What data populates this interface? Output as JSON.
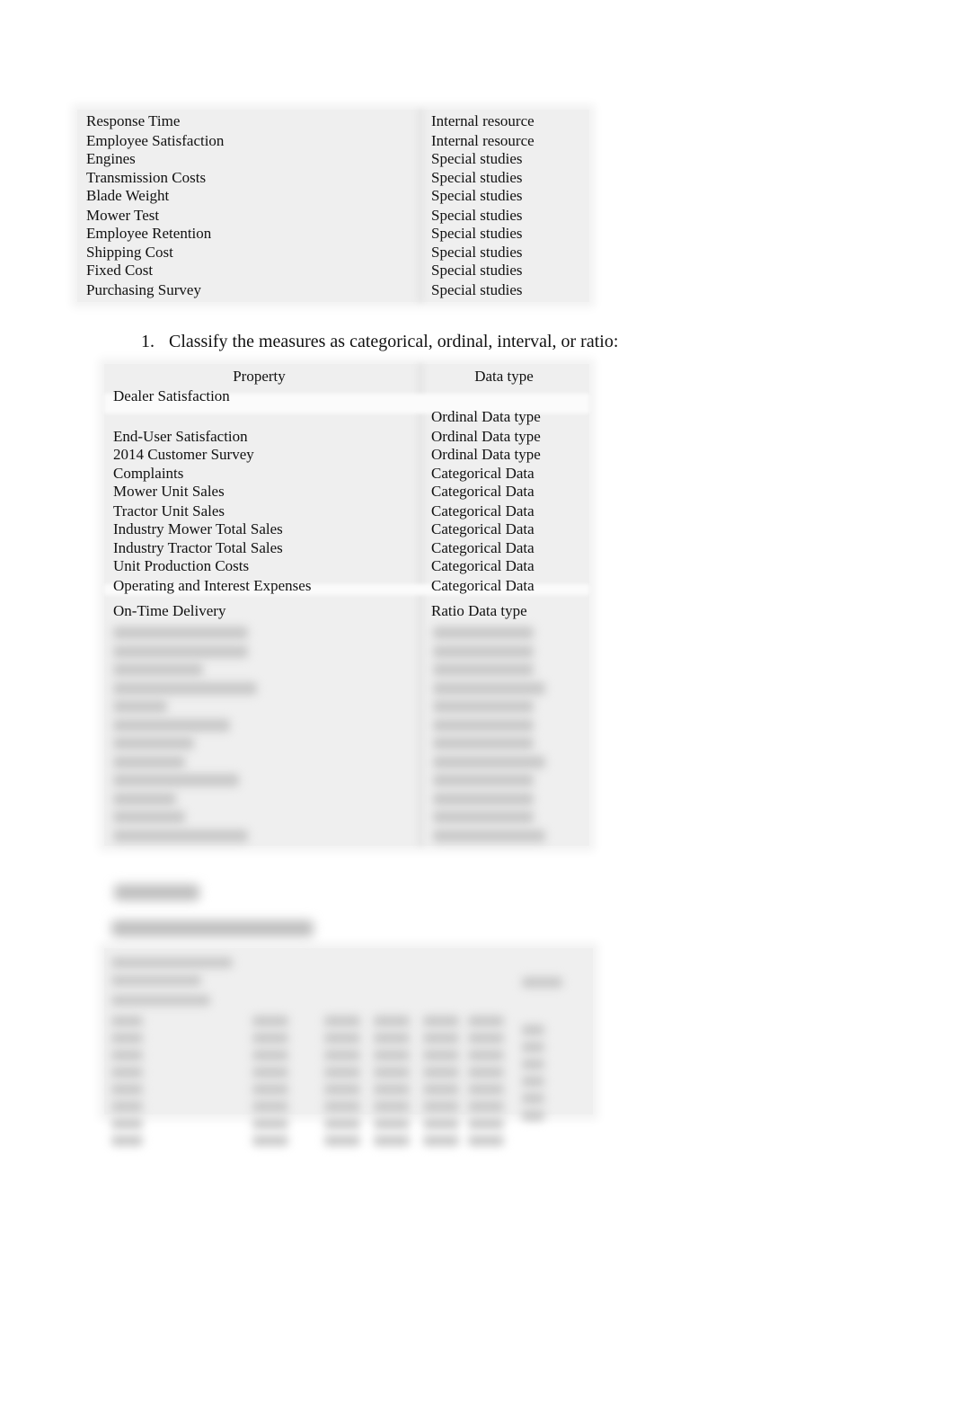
{
  "sources_table": {
    "rows": [
      {
        "measure": "Response Time",
        "source": "Internal resource"
      },
      {
        "measure": "Employee Satisfaction",
        "source": "Internal resource"
      },
      {
        "measure": "Engines",
        "source": "Special studies"
      },
      {
        "measure": "Transmission Costs",
        "source": "Special studies"
      },
      {
        "measure": "Blade Weight",
        "source": "Special studies"
      },
      {
        "measure": "Mower Test",
        "source": "Special studies"
      },
      {
        "measure": "Employee Retention",
        "source": "Special studies"
      },
      {
        "measure": "Shipping Cost",
        "source": "Special studies"
      },
      {
        "measure": "Fixed Cost",
        "source": "Special studies"
      },
      {
        "measure": "Purchasing Survey",
        "source": "Special studies"
      }
    ]
  },
  "question": {
    "number": "1.",
    "text": "Classify the measures as categorical, ordinal, interval, or ratio:"
  },
  "classification_table": {
    "headers": {
      "property": "Property",
      "data_type": "Data type"
    },
    "rows": [
      {
        "property": "Dealer Satisfaction",
        "data_type": ""
      },
      {
        "property": "",
        "data_type": "Ordinal Data type"
      },
      {
        "property": "End-User Satisfaction",
        "data_type": "Ordinal Data type"
      },
      {
        "property": "2014 Customer Survey",
        "data_type": "Ordinal Data type"
      },
      {
        "property": "Complaints",
        "data_type": "Categorical Data"
      },
      {
        "property": "Mower Unit Sales",
        "data_type": "Categorical Data"
      },
      {
        "property": "Tractor Unit Sales",
        "data_type": "Categorical Data"
      },
      {
        "property": "Industry Mower Total Sales",
        "data_type": "Categorical Data"
      },
      {
        "property": "Industry Tractor Total Sales",
        "data_type": "Categorical Data"
      },
      {
        "property": "Unit Production Costs",
        "data_type": "Categorical Data"
      },
      {
        "property": "Operating and Interest Expenses",
        "data_type": "Categorical Data"
      },
      {
        "property": "On-Time Delivery",
        "data_type": "Ratio Data type"
      }
    ],
    "blurred_row_count": 12
  },
  "blurred_section": {
    "note": "Remaining content is blurred / not legible"
  }
}
